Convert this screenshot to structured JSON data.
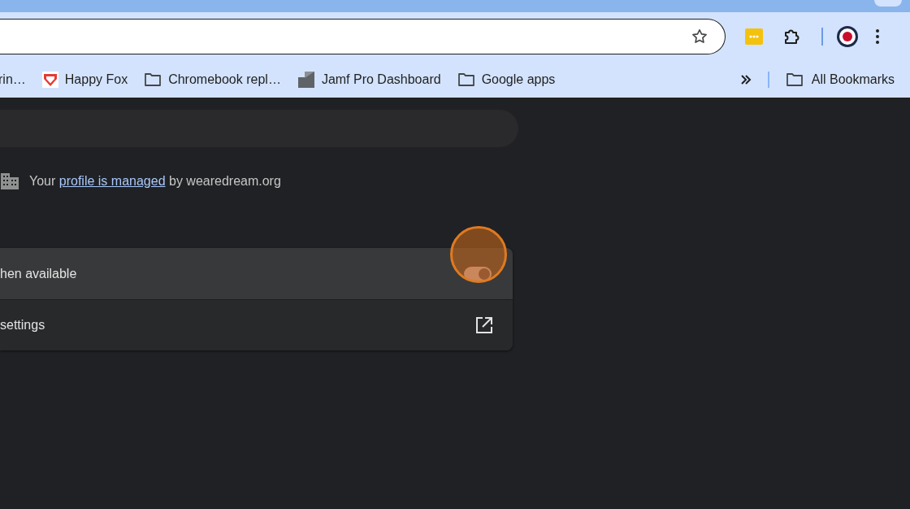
{
  "bookmarks": [
    {
      "kind": "cut",
      "label": "rin…"
    },
    {
      "kind": "heart",
      "label": "Happy Fox"
    },
    {
      "kind": "folder",
      "label": "Chromebook repl…"
    },
    {
      "kind": "jamf",
      "label": "Jamf Pro Dashboard"
    },
    {
      "kind": "folder",
      "label": "Google apps"
    }
  ],
  "all_bookmarks": {
    "label": "All Bookmarks"
  },
  "managed": {
    "prefix": "Your",
    "link": "profile is managed",
    "suffix": "by wearedream.org"
  },
  "settings_rows": [
    {
      "kind": "toggle",
      "label": "hen available",
      "on": true,
      "highlighted": true
    },
    {
      "kind": "external",
      "label": "settings"
    }
  ]
}
